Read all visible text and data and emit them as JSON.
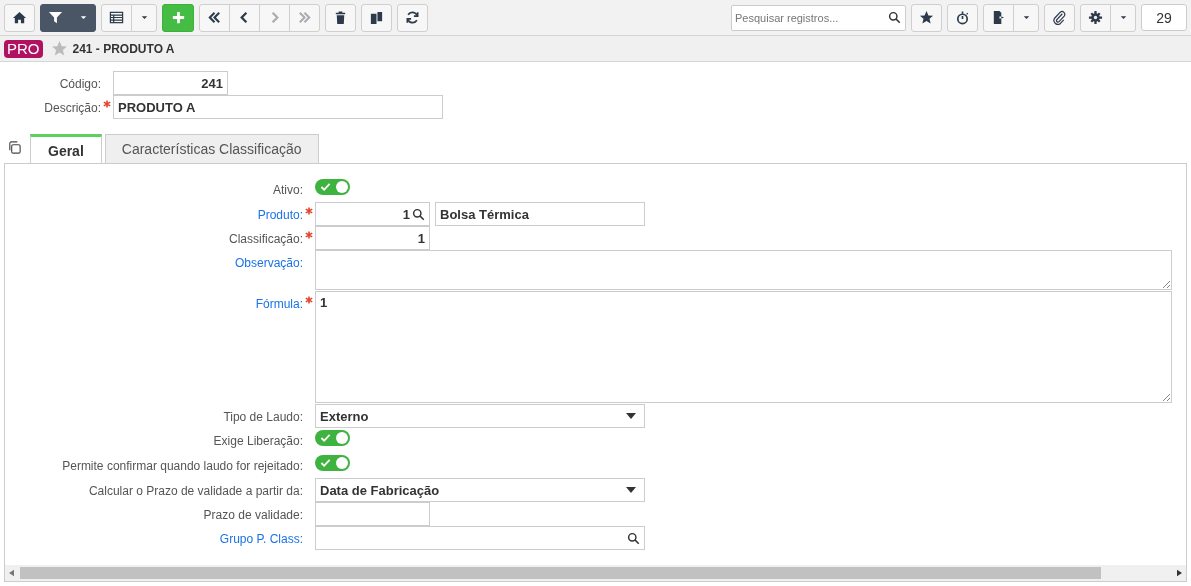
{
  "toolbar_left": [
    [
      {
        "kind": "home",
        "active": false,
        "disabled": false
      }
    ],
    [
      {
        "kind": "filter",
        "active": true,
        "disabled": false
      },
      {
        "kind": "caret",
        "active": true,
        "disabled": false
      }
    ],
    [
      {
        "kind": "grid",
        "active": false,
        "disabled": false
      },
      {
        "kind": "caret",
        "active": false,
        "disabled": false
      }
    ],
    [
      {
        "kind": "add",
        "active": false,
        "disabled": false
      }
    ],
    [
      {
        "kind": "first",
        "active": false,
        "disabled": false
      },
      {
        "kind": "prev",
        "active": false,
        "disabled": false
      },
      {
        "kind": "next",
        "active": false,
        "disabled": true
      },
      {
        "kind": "last",
        "active": false,
        "disabled": true
      }
    ],
    [
      {
        "kind": "trash",
        "active": false,
        "disabled": false
      }
    ],
    [
      {
        "kind": "copy",
        "active": false,
        "disabled": false
      }
    ],
    [
      {
        "kind": "refresh",
        "active": false,
        "disabled": false
      }
    ]
  ],
  "search": {
    "placeholder": "Pesquisar registros..."
  },
  "toolbar_right": [
    [
      {
        "kind": "star",
        "active": false,
        "disabled": false
      }
    ],
    [
      {
        "kind": "stopwatch",
        "active": false,
        "disabled": false
      }
    ],
    [
      {
        "kind": "export",
        "active": false,
        "disabled": false
      },
      {
        "kind": "caret",
        "active": false,
        "disabled": false
      }
    ],
    [
      {
        "kind": "attach",
        "active": false,
        "disabled": false
      }
    ],
    [
      {
        "kind": "gear",
        "active": false,
        "disabled": false
      },
      {
        "kind": "caret",
        "active": false,
        "disabled": false
      }
    ]
  ],
  "counter": "29",
  "header": {
    "badge": "PRO",
    "favorite": false,
    "title": "241 - PRODUTO A"
  },
  "record": {
    "code_label": "Código:",
    "code": "241",
    "description_label": "Descrição:",
    "description_required": true,
    "description": "PRODUTO A"
  },
  "tabs": [
    {
      "label": "Geral",
      "selected": true
    },
    {
      "label": "Características Classificação",
      "selected": false
    }
  ],
  "fields": [
    {
      "kind": "toggle",
      "label": "Ativo:",
      "link": false,
      "required": false,
      "on": true
    },
    {
      "kind": "lookup",
      "label": "Produto:",
      "link": true,
      "required": true,
      "value": "1",
      "detail": "Bolsa Térmica"
    },
    {
      "kind": "number",
      "label": "Classificação:",
      "link": false,
      "required": true,
      "value": "1"
    },
    {
      "kind": "memo",
      "label": "Observação:",
      "link": true,
      "required": false
    },
    {
      "kind": "formula",
      "label": "Fórmula:",
      "link": true,
      "required": true,
      "value": "1"
    },
    {
      "kind": "select",
      "label": "Tipo de Laudo:",
      "link": false,
      "required": false,
      "value": "Externo"
    },
    {
      "kind": "toggle",
      "label": "Exige Liberação:",
      "link": false,
      "required": false,
      "on": true
    },
    {
      "kind": "toggle",
      "label": "Permite confirmar quando laudo for rejeitado:",
      "link": false,
      "required": false,
      "on": true
    },
    {
      "kind": "select",
      "label": "Calcular o Prazo de validade a partir da:",
      "link": false,
      "required": false,
      "value": "Data de Fabricação"
    },
    {
      "kind": "number",
      "label": "Prazo de validade:",
      "link": false,
      "required": false
    },
    {
      "kind": "search",
      "label": "Grupo P. Class:",
      "link": true,
      "required": false
    }
  ]
}
